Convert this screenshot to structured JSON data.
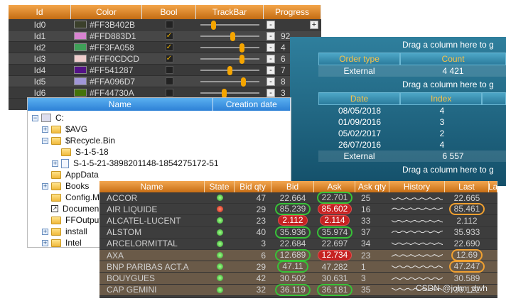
{
  "grid_colors": {
    "headers": [
      "Id",
      "Color",
      "Bool",
      "TrackBar",
      "Progress"
    ],
    "rows": [
      {
        "id": "Id0",
        "color": "#FF3B402B",
        "swatch": "#3B402B",
        "checked": false,
        "track": 0.2,
        "progress": ""
      },
      {
        "id": "Id1",
        "color": "#FFD883D1",
        "swatch": "#D883D1",
        "checked": true,
        "track": 0.55,
        "progress": "92"
      },
      {
        "id": "Id2",
        "color": "#FF3FA058",
        "swatch": "#3FA058",
        "checked": true,
        "track": 0.72,
        "progress": "4"
      },
      {
        "id": "Id3",
        "color": "#FFF0CDCD",
        "swatch": "#F0CDCD",
        "checked": true,
        "track": 0.72,
        "progress": "6"
      },
      {
        "id": "Id4",
        "color": "#FF541287",
        "swatch": "#541287",
        "checked": false,
        "track": 0.5,
        "progress": "7"
      },
      {
        "id": "Id5",
        "color": "#FFA096D7",
        "swatch": "#A096D7",
        "checked": false,
        "track": 0.75,
        "progress": "8"
      },
      {
        "id": "Id6",
        "color": "#FF44730A",
        "swatch": "#44730A",
        "checked": false,
        "track": 0.4,
        "progress": "3"
      }
    ],
    "minus": "-",
    "plus": "+"
  },
  "group_grid": {
    "drag_hint": "Drag a column here to g",
    "level1": {
      "headers": [
        "Order type",
        "Count"
      ],
      "row": {
        "type": "External",
        "count": "4 421"
      }
    },
    "level2": {
      "headers": [
        "Date",
        "Index"
      ],
      "rows": [
        {
          "date": "08/05/2018",
          "index": "4"
        },
        {
          "date": "01/09/2016",
          "index": "3"
        },
        {
          "date": "05/02/2017",
          "index": "2"
        },
        {
          "date": "26/07/2016",
          "index": "4"
        }
      ],
      "footer": {
        "type": "External",
        "count": "6 557"
      }
    }
  },
  "file_tree": {
    "headers": [
      "Name",
      "Creation date"
    ],
    "items": [
      {
        "label": "C:",
        "level": 0,
        "expander": "-",
        "icon": "drive"
      },
      {
        "label": "$AVG",
        "level": 1,
        "expander": "+",
        "icon": "folder"
      },
      {
        "label": "$Recycle.Bin",
        "level": 1,
        "expander": "-",
        "icon": "folder"
      },
      {
        "label": "S-1-5-18",
        "level": 2,
        "expander": "",
        "icon": "folder"
      },
      {
        "label": "S-1-5-21-3898201148-1854275172-51",
        "level": 2,
        "expander": "+",
        "icon": "file"
      },
      {
        "label": "AppData",
        "level": 1,
        "expander": "",
        "icon": "folder"
      },
      {
        "label": "Books",
        "level": 1,
        "expander": "+",
        "icon": "folder"
      },
      {
        "label": "Config.Ms",
        "level": 1,
        "expander": "",
        "icon": "folder"
      },
      {
        "label": "Documen",
        "level": 1,
        "expander": "",
        "icon": "shortcut"
      },
      {
        "label": "FFOutput",
        "level": 1,
        "expander": "",
        "icon": "folder"
      },
      {
        "label": "install",
        "level": 1,
        "expander": "+",
        "icon": "folder"
      },
      {
        "label": "Intel",
        "level": 1,
        "expander": "+",
        "icon": "folder"
      }
    ]
  },
  "stock_grid": {
    "headers": [
      "Name",
      "State",
      "Bid qty",
      "Bid",
      "Ask",
      "Ask qty",
      "History",
      "Last",
      "La"
    ],
    "rows": [
      {
        "name": "ACCOR",
        "state": "green",
        "bidqty": "47",
        "bid": "22.664",
        "ask": "22.701",
        "askqty": "25",
        "last": "22.665",
        "bidStyle": "",
        "askStyle": "g",
        "lastStyle": "",
        "selected": false
      },
      {
        "name": "AIR LIQUIDE",
        "state": "red",
        "bidqty": "29",
        "bid": "85.239",
        "ask": "85.602",
        "askqty": "16",
        "last": "85.461",
        "bidStyle": "g",
        "askStyle": "r",
        "lastStyle": "o",
        "selected": false
      },
      {
        "name": "ALCATEL-LUCENT",
        "state": "green",
        "bidqty": "23",
        "bid": "2.112",
        "ask": "2.114",
        "askqty": "33",
        "last": "2.112",
        "bidStyle": "r",
        "askStyle": "r",
        "lastStyle": "",
        "selected": false
      },
      {
        "name": "ALSTOM",
        "state": "green",
        "bidqty": "40",
        "bid": "35.936",
        "ask": "35.974",
        "askqty": "37",
        "last": "35.933",
        "bidStyle": "g",
        "askStyle": "g",
        "lastStyle": "",
        "selected": false
      },
      {
        "name": "ARCELORMITTAL",
        "state": "green",
        "bidqty": "3",
        "bid": "22.684",
        "ask": "22.697",
        "askqty": "34",
        "last": "22.690",
        "bidStyle": "",
        "askStyle": "",
        "lastStyle": "",
        "selected": false
      },
      {
        "name": "AXA",
        "state": "green",
        "bidqty": "6",
        "bid": "12.689",
        "ask": "12.734",
        "askqty": "23",
        "last": "12.69",
        "bidStyle": "g",
        "askStyle": "r",
        "lastStyle": "o",
        "selected": true
      },
      {
        "name": "BNP PARIBAS ACT.A",
        "state": "green",
        "bidqty": "29",
        "bid": "47.11",
        "ask": "47.282",
        "askqty": "1",
        "last": "47.247",
        "bidStyle": "g",
        "askStyle": "",
        "lastStyle": "o",
        "selected": true
      },
      {
        "name": "BOUYGUES",
        "state": "green",
        "bidqty": "42",
        "bid": "30.502",
        "ask": "30.631",
        "askqty": "3",
        "last": "30.589",
        "bidStyle": "",
        "askStyle": "",
        "lastStyle": "",
        "selected": true
      },
      {
        "name": "CAP GEMINI",
        "state": "green",
        "bidqty": "32",
        "bid": "36.119",
        "ask": "36.181",
        "askqty": "35",
        "last": "36.122",
        "bidStyle": "g",
        "askStyle": "g",
        "lastStyle": "",
        "selected": true
      }
    ]
  },
  "watermark": "CSDN @john_dwh"
}
